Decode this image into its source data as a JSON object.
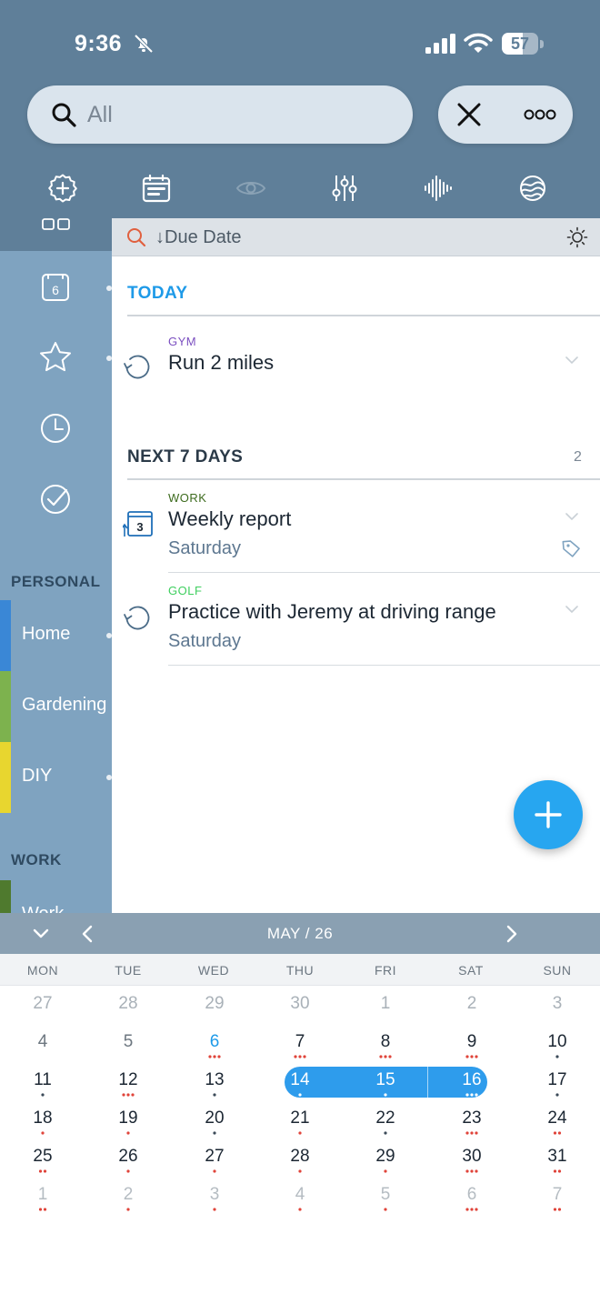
{
  "status_bar": {
    "time": "9:36",
    "battery": "57",
    "battery_level": 0.57
  },
  "search": {
    "text": "All"
  },
  "toolbar": {
    "icons": [
      "add-circle-icon",
      "calendar-list-icon",
      "eye-icon",
      "sliders-icon",
      "waveform-icon",
      "globe-icon"
    ]
  },
  "sidebar": {
    "sections": [
      {
        "title": "PERSONAL",
        "items": [
          {
            "label": "Home",
            "color": "#3a87d6"
          },
          {
            "label": "Gardening",
            "color": "#7db24e"
          },
          {
            "label": "DIY",
            "color": "#e8d62f"
          }
        ]
      },
      {
        "title": "WORK",
        "items": [
          {
            "label": "Work",
            "color": "#4f7a2e"
          }
        ]
      }
    ],
    "calendar_icon_day": "6"
  },
  "sort_bar": {
    "label": "Due Date"
  },
  "groups": [
    {
      "title": "TODAY",
      "count": "",
      "color": "#1e9ae8",
      "tasks": [
        {
          "tag": "GYM",
          "tag_color": "#7b4fc0",
          "title": "Run 2 miles",
          "due": "",
          "icon": "repeat-icon"
        }
      ]
    },
    {
      "title": "NEXT 7 DAYS",
      "count": "2",
      "color": "#2b3a48",
      "tasks": [
        {
          "tag": "WORK",
          "tag_color": "#3d6b1e",
          "title": "Weekly report",
          "due": "Saturday",
          "icon": "recurring-calendar-icon",
          "icon_day": "3",
          "has_note": true
        },
        {
          "tag": "GOLF",
          "tag_color": "#3fcf5f",
          "title": "Practice with Jeremy at driving range",
          "due": "Saturday",
          "icon": "repeat-icon"
        }
      ]
    }
  ],
  "calendar": {
    "title": "MAY / 26",
    "weekdays": [
      "MON",
      "TUE",
      "WED",
      "THU",
      "FRI",
      "SAT",
      "SUN"
    ],
    "selected_range": [
      "14",
      "15",
      "16"
    ],
    "weeks": [
      [
        {
          "d": "27",
          "muted": true
        },
        {
          "d": "28",
          "muted": true
        },
        {
          "d": "29",
          "muted": true
        },
        {
          "d": "30",
          "muted": true
        },
        {
          "d": "1",
          "muted": true
        },
        {
          "d": "2",
          "muted": true
        },
        {
          "d": "3",
          "muted": true
        }
      ],
      [
        {
          "d": "4",
          "muted": true
        },
        {
          "d": "5",
          "muted": true
        },
        {
          "d": "6",
          "today": true,
          "dots": [
            "r",
            "r",
            "r"
          ]
        },
        {
          "d": "7",
          "dots": [
            "r",
            "r",
            "r"
          ]
        },
        {
          "d": "8",
          "dots": [
            "r",
            "r",
            "r"
          ]
        },
        {
          "d": "9",
          "dots": [
            "r",
            "r",
            "r"
          ]
        },
        {
          "d": "10",
          "dots": [
            "b"
          ]
        }
      ],
      [
        {
          "d": "11",
          "dots": [
            "b"
          ]
        },
        {
          "d": "12",
          "dots": [
            "r",
            "r",
            "r"
          ]
        },
        {
          "d": "13",
          "dots": [
            "b"
          ]
        },
        {
          "d": "14",
          "dots": [
            "w"
          ]
        },
        {
          "d": "15",
          "dots": [
            "w"
          ]
        },
        {
          "d": "16",
          "dots": [
            "w",
            "w",
            "w"
          ]
        },
        {
          "d": "17",
          "dots": [
            "b"
          ]
        }
      ],
      [
        {
          "d": "18",
          "dots": [
            "r"
          ]
        },
        {
          "d": "19",
          "dots": [
            "r"
          ]
        },
        {
          "d": "20",
          "dots": [
            "b"
          ]
        },
        {
          "d": "21",
          "dots": [
            "r"
          ]
        },
        {
          "d": "22",
          "dots": [
            "b"
          ]
        },
        {
          "d": "23",
          "dots": [
            "r",
            "r",
            "r"
          ]
        },
        {
          "d": "24",
          "dots": [
            "r",
            "r"
          ]
        }
      ],
      [
        {
          "d": "25",
          "dots": [
            "r",
            "r"
          ]
        },
        {
          "d": "26",
          "dots": [
            "r"
          ]
        },
        {
          "d": "27",
          "dots": [
            "r"
          ]
        },
        {
          "d": "28",
          "dots": [
            "r"
          ]
        },
        {
          "d": "29",
          "dots": [
            "r"
          ]
        },
        {
          "d": "30",
          "dots": [
            "r",
            "r",
            "r"
          ]
        },
        {
          "d": "31",
          "dots": [
            "r",
            "r"
          ]
        }
      ],
      [
        {
          "d": "1",
          "muted": true,
          "dots": [
            "r",
            "r"
          ]
        },
        {
          "d": "2",
          "muted": true,
          "dots": [
            "r"
          ]
        },
        {
          "d": "3",
          "muted": true,
          "dots": [
            "r"
          ]
        },
        {
          "d": "4",
          "muted": true,
          "dots": [
            "r"
          ]
        },
        {
          "d": "5",
          "muted": true,
          "dots": [
            "r"
          ]
        },
        {
          "d": "6",
          "muted": true,
          "dots": [
            "r",
            "r",
            "r"
          ]
        },
        {
          "d": "7",
          "muted": true,
          "dots": [
            "r",
            "r"
          ]
        }
      ]
    ]
  },
  "colors": {
    "accent": "#27a6f0",
    "header": "#5f7f99",
    "sidebar": "#7fa3c0",
    "dot_red": "#e0443a"
  }
}
